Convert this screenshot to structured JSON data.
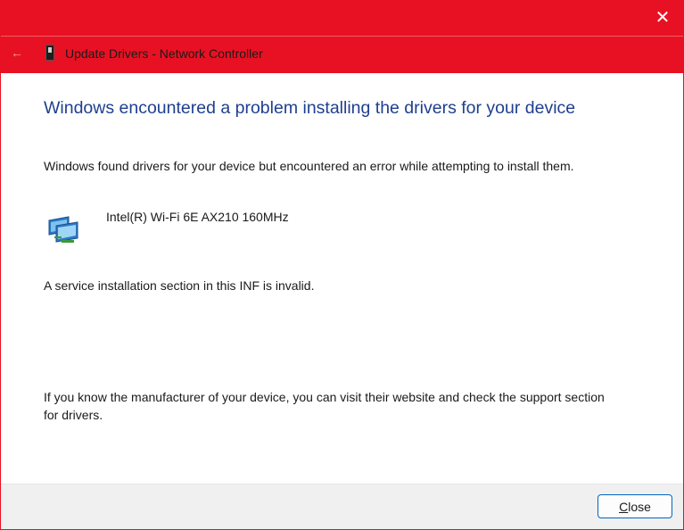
{
  "window": {
    "accent_color": "#e81123",
    "close_icon": "close-icon"
  },
  "nav": {
    "back_icon": "back-arrow-icon",
    "device_icon": "device-icon",
    "title": "Update Drivers - Network Controller"
  },
  "content": {
    "heading": "Windows encountered a problem installing the drivers for your device",
    "description": "Windows found drivers for your device but encountered an error while attempting to install them.",
    "device": {
      "icon": "network-adapter-icon",
      "name": "Intel(R) Wi-Fi 6E AX210 160MHz"
    },
    "error_message": "A service installation section in this INF is invalid.",
    "help_text": "If you know the manufacturer of your device, you can visit their website and check the support section for drivers."
  },
  "footer": {
    "close_mnemonic": "C",
    "close_rest": "lose"
  }
}
